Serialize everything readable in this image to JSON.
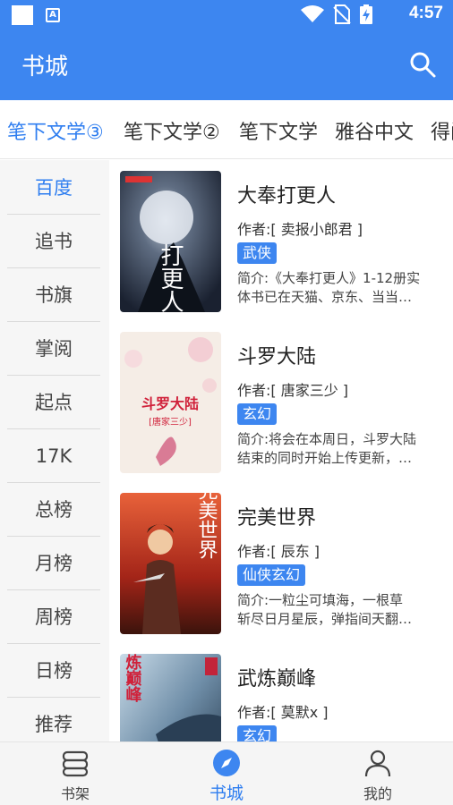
{
  "status_bar": {
    "time": "4:57",
    "notification_icon": "a-icon",
    "icons": [
      "square-icon",
      "a-icon",
      "wifi-icon",
      "no-sim-icon",
      "battery-charging-icon"
    ]
  },
  "app_bar": {
    "title": "书城",
    "search_icon": "search-icon"
  },
  "colors": {
    "primary": "#3d86f0",
    "accent_text": "#2f7ef0",
    "sidebar_bg": "#f6f6f6"
  },
  "source_tabs": [
    {
      "label": "笔下文学③",
      "active": true
    },
    {
      "label": "笔下文学②",
      "active": false
    },
    {
      "label": "笔下文学",
      "active": false
    },
    {
      "label": "雅谷中文",
      "active": false
    },
    {
      "label": "得间",
      "active": false
    }
  ],
  "categories": [
    {
      "label": "百度",
      "active": true
    },
    {
      "label": "追书",
      "active": false
    },
    {
      "label": "书旗",
      "active": false
    },
    {
      "label": "掌阅",
      "active": false
    },
    {
      "label": "起点",
      "active": false
    },
    {
      "label": "17K",
      "active": false
    },
    {
      "label": "总榜",
      "active": false
    },
    {
      "label": "月榜",
      "active": false
    },
    {
      "label": "周榜",
      "active": false
    },
    {
      "label": "日榜",
      "active": false
    },
    {
      "label": "推荐",
      "active": false
    }
  ],
  "books": [
    {
      "title": "大奉打更人",
      "author": "作者:[ 卖报小郎君 ]",
      "tag": "武侠",
      "intro_line1": "简介:《大奉打更人》1-12册实",
      "intro_line2": "体书已在天猫、京东、当当…",
      "cover_text": "打更人"
    },
    {
      "title": "斗罗大陆",
      "author": "作者:[ 唐家三少 ]",
      "tag": "玄幻",
      "intro_line1": "简介:将会在本周日，斗罗大陆",
      "intro_line2": "结束的同时开始上传更新，…",
      "cover_text": "斗罗大陆",
      "cover_subtext": "[唐家三少]"
    },
    {
      "title": "完美世界",
      "author": "作者:[ 辰东 ]",
      "tag": "仙侠玄幻",
      "intro_line1": "简介:一粒尘可填海，一根草",
      "intro_line2": "斩尽日月星辰，弹指间天翻…",
      "cover_text": "完美世界"
    },
    {
      "title": "武炼巅峰",
      "author": "作者:[ 莫默x ]",
      "tag": "玄幻",
      "intro_line1": "",
      "intro_line2": "",
      "cover_text": "武炼巅峰"
    }
  ],
  "bottom_nav": [
    {
      "label": "书架",
      "icon": "bookshelf-icon",
      "active": false
    },
    {
      "label": "书城",
      "icon": "compass-icon",
      "active": true
    },
    {
      "label": "我的",
      "icon": "person-icon",
      "active": false
    }
  ]
}
